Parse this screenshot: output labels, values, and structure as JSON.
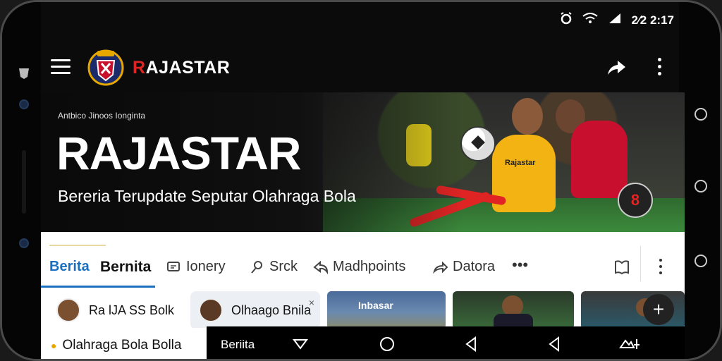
{
  "status_bar": {
    "time": "2∕2 2:17"
  },
  "app_bar": {
    "brand_prefix": "R",
    "brand_rest": "AJASTAR"
  },
  "hero": {
    "kicker": "Antbico  Jinoos  Ionginta",
    "title": "RAJASTAR",
    "subtitle": "Bereria Terupdate Seputar Olahraga Bola",
    "badge": "8",
    "jersey_text": "Rajastar"
  },
  "tabs": {
    "items": [
      {
        "label": "Berita",
        "icon": ""
      },
      {
        "label": "Bernita",
        "icon": ""
      },
      {
        "label": "Ionery",
        "icon": "chat-icon"
      },
      {
        "label": "Srck",
        "icon": "pin-icon"
      },
      {
        "label": "Madhpoints",
        "icon": "share-arrow-icon"
      },
      {
        "label": "Datora",
        "icon": "forward-arrow-icon"
      }
    ],
    "more": "•••"
  },
  "cards": {
    "chip1": "Ra lJA SS Bolk",
    "chip2": "Olhaago Bnila",
    "chip2_close": "×",
    "thumb_label": "Inbasar",
    "fab": "+",
    "bottom_chip": "Olahraga Bola  Bolla"
  },
  "navbar": {
    "tab": "Beriita"
  },
  "colors": {
    "accent": "#1a6fbf",
    "brand_red": "#e02424",
    "jersey_yellow": "#f3b313",
    "jersey_red": "#c8102e"
  }
}
